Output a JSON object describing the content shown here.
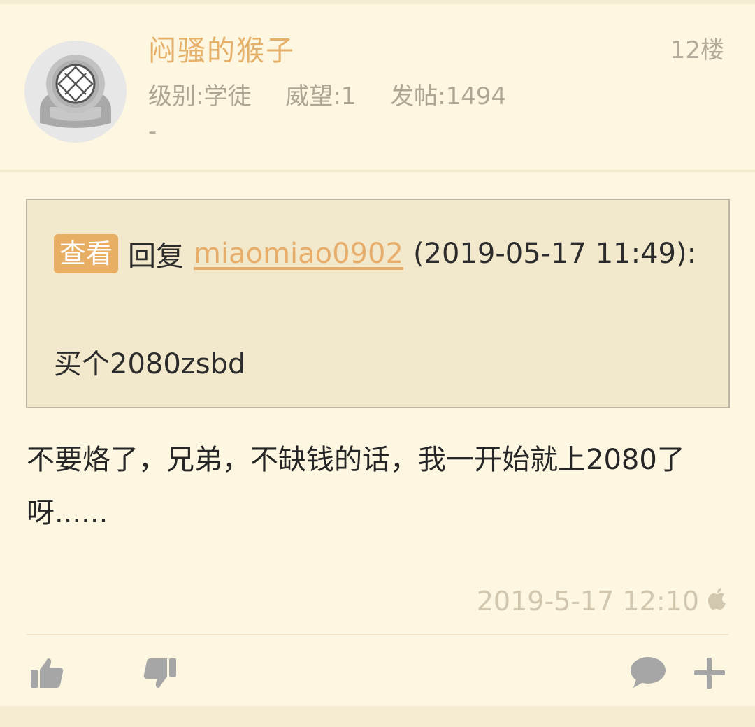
{
  "post": {
    "username": "闷骚的猴子",
    "floor": "12楼",
    "level": "级别:学徒",
    "prestige": "威望:1",
    "posts": "发帖:1494",
    "signature": "-"
  },
  "quote": {
    "view_label": "查看",
    "reply_label": "回复",
    "quoted_user": "miaomiao0902",
    "quoted_time": "(2019-05-17 11:49):",
    "quoted_text": "买个2080zsbd"
  },
  "content": {
    "text": "不要烙了，兄弟，不缺钱的话，我一开始就上2080了呀......"
  },
  "footer": {
    "timestamp": "2019-5-17 12:10",
    "device_icon": "apple-icon"
  },
  "actions": {
    "icons": [
      "thumbs-up-icon",
      "thumbs-down-icon",
      "comment-icon",
      "plus-icon"
    ]
  },
  "colors": {
    "background": "#fdf6e1",
    "accent": "#e8ae64",
    "quote_background": "#f2e8cb",
    "muted_text": "#aea693",
    "icon_gray": "#a6a6a6"
  }
}
